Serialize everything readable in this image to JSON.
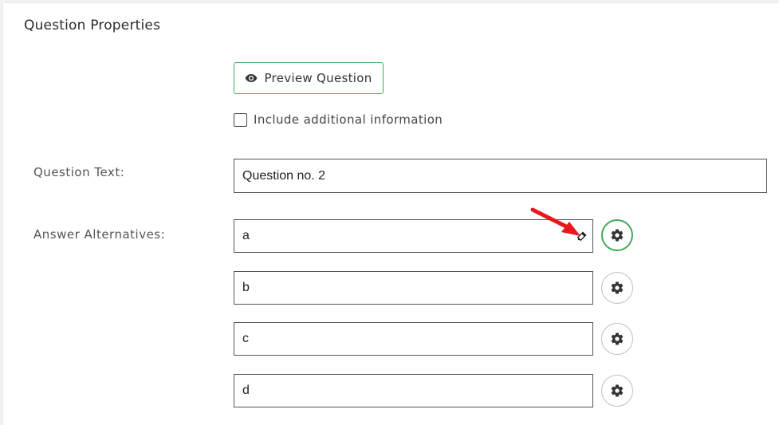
{
  "section": {
    "title": "Question Properties"
  },
  "preview": {
    "label": "Preview Question",
    "icon": "eye-icon"
  },
  "additional_info": {
    "label": "Include additional information",
    "checked": false
  },
  "question_text": {
    "label": "Question Text:",
    "value": "Question no. 2"
  },
  "answers": {
    "label": "Answer Alternatives:",
    "items": [
      {
        "value": "a",
        "settings_icon": "gear-icon",
        "active": true
      },
      {
        "value": "b",
        "settings_icon": "gear-icon",
        "active": false
      },
      {
        "value": "c",
        "settings_icon": "gear-icon",
        "active": false
      },
      {
        "value": "d",
        "settings_icon": "gear-icon",
        "active": false
      }
    ]
  },
  "colors": {
    "accent_green": "#45a85a",
    "annotation_arrow": "#e8191c"
  }
}
